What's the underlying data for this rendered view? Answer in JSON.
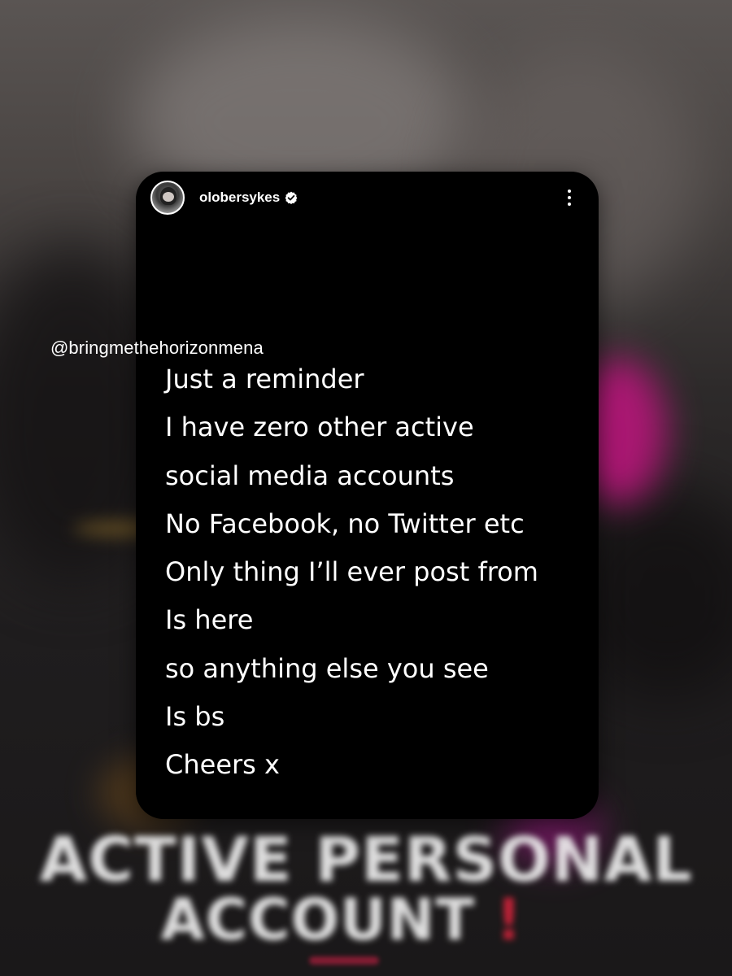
{
  "story": {
    "username": "olobersykes",
    "verified": true,
    "avatar_icon": "avatar",
    "menu_icon": "more-vertical-icon",
    "lines": [
      "Just a reminder",
      "I have zero other active",
      "social media accounts",
      "No Facebook, no Twitter etc",
      "Only thing I’ll ever post from",
      "Is here",
      "so anything else you see",
      "Is bs",
      "Cheers x"
    ]
  },
  "watermark": "@bringmethehorizonmena",
  "background": {
    "title_line_1": "ACTIVE PERSONAL",
    "title_line_2": "ACCOUNT",
    "title_mark": "!"
  },
  "colors": {
    "card_background": "#000000",
    "text": "#ffffff",
    "verified_badge": "#ffffff",
    "accent_magenta": "#c0157f"
  }
}
